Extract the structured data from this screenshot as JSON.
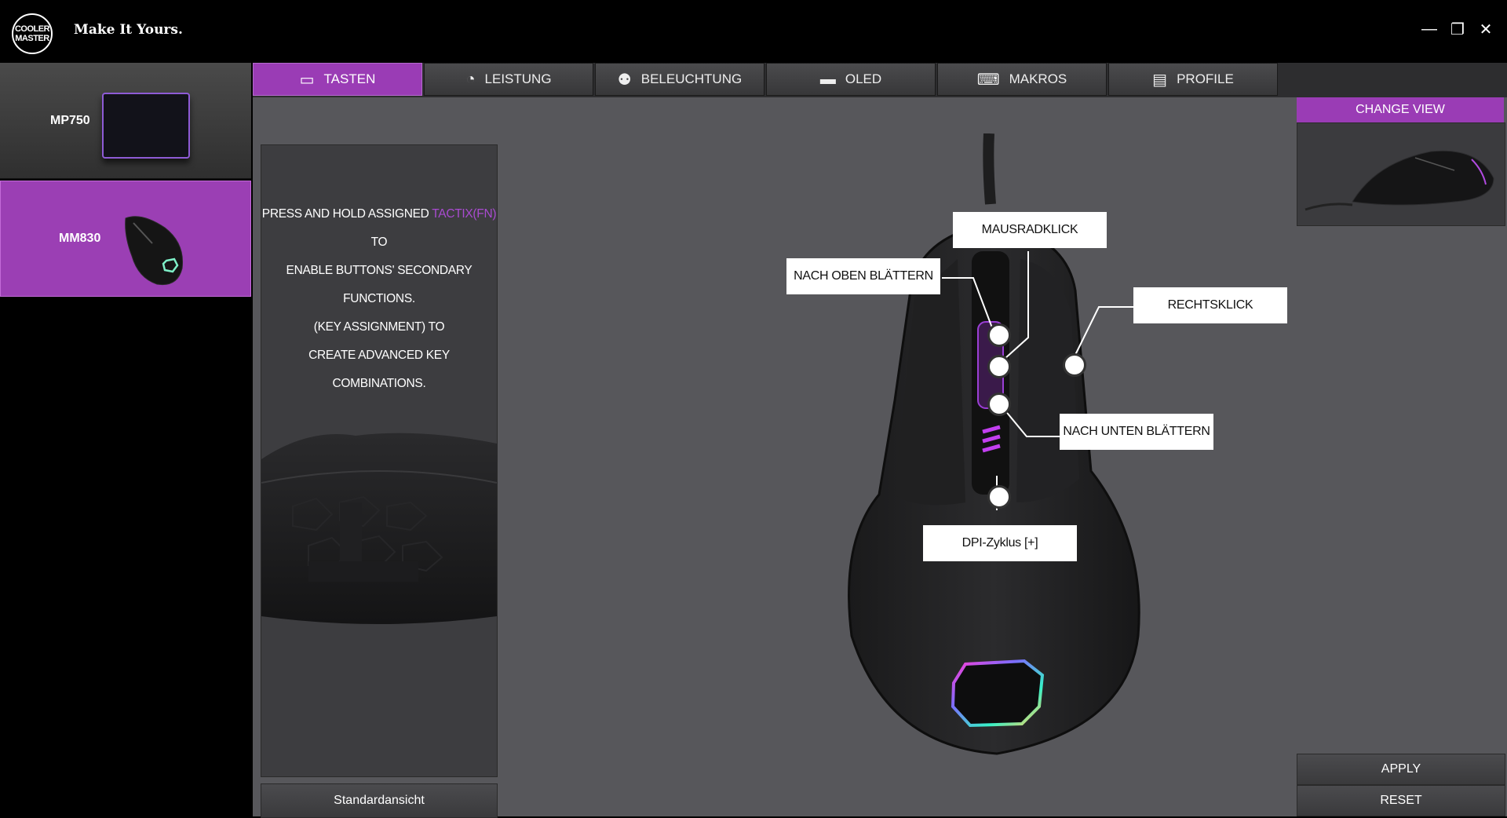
{
  "app": {
    "logo_line1": "COOLER",
    "logo_line2": "MASTER",
    "tagline": "Make It Yours."
  },
  "window_controls": {
    "minimize": "—",
    "restore": "❐",
    "close": "✕"
  },
  "devices": [
    {
      "name": "MP750",
      "selected": false
    },
    {
      "name": "MM830",
      "selected": true
    }
  ],
  "tabs": [
    {
      "label": "TASTEN",
      "icon": "mouse-icon",
      "glyph": "▭",
      "active": true
    },
    {
      "label": "LEISTUNG",
      "icon": "gauge-icon",
      "glyph": "◔",
      "active": false
    },
    {
      "label": "BELEUCHTUNG",
      "icon": "bulb-icon",
      "glyph": "⚉",
      "active": false
    },
    {
      "label": "OLED",
      "icon": "oled-icon",
      "glyph": "▬",
      "active": false
    },
    {
      "label": "MAKROS",
      "icon": "macro-icon",
      "glyph": "⌨",
      "active": false
    },
    {
      "label": "PROFILE",
      "icon": "profile-icon",
      "glyph": "▤",
      "active": false
    }
  ],
  "info": {
    "line1_pre": "PRESS AND HOLD ASSIGNED ",
    "line1_highlight": "TACTIX(FN)",
    "line1_post": " TO",
    "line2": "ENABLE BUTTONS' SECONDARY FUNCTIONS.",
    "line3": "(KEY ASSIGNMENT) TO",
    "line4": "CREATE ADVANCED KEY COMBINATIONS.",
    "highlight_color": "#a94bd0"
  },
  "default_view_label": "Standardansicht",
  "buttons": {
    "scroll_up": "NACH OBEN BLÄTTERN",
    "wheel_click": "MAUSRADKLICK",
    "right_click": "RECHTSKLICK",
    "scroll_down": "NACH UNTEN BLÄTTERN",
    "dpi_cycle": "DPI-Zyklus [+]"
  },
  "right_panel": {
    "change_view": "CHANGE VIEW",
    "apply": "APPLY",
    "reset": "RESET"
  },
  "colors": {
    "accent": "#9a3cb5",
    "panel": "#57575b",
    "background": "#000000"
  }
}
